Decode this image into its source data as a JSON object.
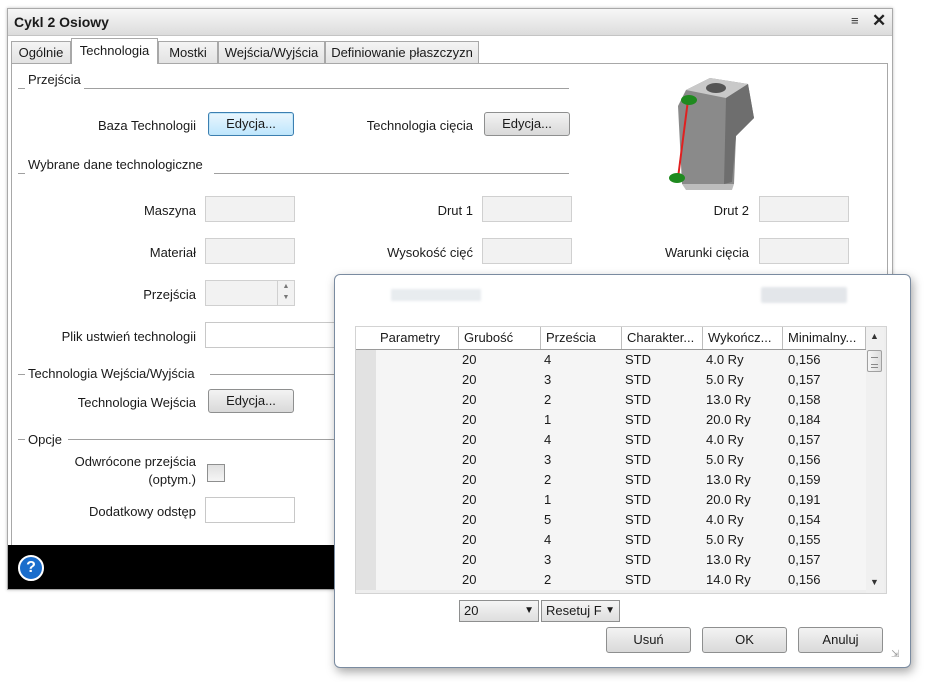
{
  "window": {
    "title": "Cykl 2 Osiowy"
  },
  "tabs": [
    {
      "label": "Ogólnie"
    },
    {
      "label": "Technologia"
    },
    {
      "label": "Mostki"
    },
    {
      "label": "Wejścia/Wyjścia"
    },
    {
      "label": "Definiowanie płaszczyzn"
    }
  ],
  "przejscia": {
    "group_label": "Przejścia",
    "baza_label": "Baza Technologii",
    "baza_button": "Edycja...",
    "ciecia_label": "Technologia cięcia",
    "ciecia_button": "Edycja..."
  },
  "wybrane": {
    "group_label": "Wybrane dane technologiczne",
    "maszyna_label": "Maszyna",
    "drut1_label": "Drut 1",
    "drut2_label": "Drut 2",
    "material_label": "Materiał",
    "wysokosc_label": "Wysokość cięć",
    "warunki_label": "Warunki cięcia",
    "przejscia_label": "Przejścia",
    "plik_label": "Plik ustwień technologii"
  },
  "wejscia": {
    "group_label": "Technologia Wejścia/Wyjścia",
    "label": "Technologia Wejścia",
    "button": "Edycja..."
  },
  "opcje": {
    "group_label": "Opcje",
    "odwrocone_label_line1": "Odwrócone przejścia",
    "odwrocone_label_line2": "(optym.)",
    "odstep_label": "Dodatkowy odstęp"
  },
  "popup": {
    "headers": [
      "Parametry",
      "Grubość",
      "Prześcia",
      "Charakter...",
      "Wykończ...",
      "Minimalny..."
    ],
    "rows": [
      [
        "",
        "20",
        "4",
        "STD",
        "4.0 Ry",
        "0,156"
      ],
      [
        "",
        "20",
        "3",
        "STD",
        "5.0 Ry",
        "0,157"
      ],
      [
        "",
        "20",
        "2",
        "STD",
        "13.0 Ry",
        "0,158"
      ],
      [
        "",
        "20",
        "1",
        "STD",
        "20.0 Ry",
        "0,184"
      ],
      [
        "",
        "20",
        "4",
        "STD",
        "4.0 Ry",
        "0,157"
      ],
      [
        "",
        "20",
        "3",
        "STD",
        "5.0 Ry",
        "0,156"
      ],
      [
        "",
        "20",
        "2",
        "STD",
        "13.0 Ry",
        "0,159"
      ],
      [
        "",
        "20",
        "1",
        "STD",
        "20.0 Ry",
        "0,191"
      ],
      [
        "",
        "20",
        "5",
        "STD",
        "4.0 Ry",
        "0,154"
      ],
      [
        "",
        "20",
        "4",
        "STD",
        "5.0 Ry",
        "0,155"
      ],
      [
        "",
        "20",
        "3",
        "STD",
        "13.0 Ry",
        "0,157"
      ],
      [
        "",
        "20",
        "2",
        "STD",
        "14.0 Ry",
        "0,156"
      ]
    ],
    "thickness_select": "20",
    "reset_select": "Resetuj F",
    "delete_button": "Usuń",
    "ok_button": "OK",
    "cancel_button": "Anuluj"
  },
  "colors": {
    "accent": "#3c7fb1",
    "footer": "#000000",
    "help": "#1a6dcc"
  },
  "icons": [
    "menu-icon",
    "close-icon",
    "help-icon",
    "wire-part-preview",
    "chevron-down-icon"
  ]
}
